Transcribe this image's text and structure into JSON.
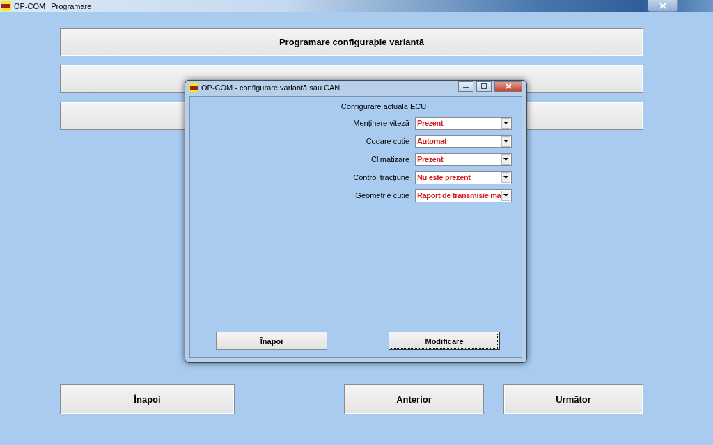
{
  "window": {
    "app_name": "OP-COM",
    "menu": "Programare"
  },
  "top_buttons": [
    {
      "label": "Programare configuraþie variantă"
    }
  ],
  "dialog": {
    "title": "OP-COM - configurare variantă sau CAN",
    "heading": "Configurare actuală ECU",
    "fields": [
      {
        "label": "Menţinere viteză",
        "value": "Prezent"
      },
      {
        "label": "Codare cutie",
        "value": "Automat"
      },
      {
        "label": "Climatizare",
        "value": "Prezent"
      },
      {
        "label": "Control tracţiune",
        "value": "Nu este prezent"
      },
      {
        "label": "Geometrie cutie",
        "value": "Raport de transmisie ma"
      }
    ],
    "buttons": [
      {
        "label": "Înapoi",
        "focused": false
      },
      {
        "label": "Modificare",
        "focused": true
      }
    ]
  },
  "bottom_buttons": [
    {
      "label": "Înapoi"
    },
    {
      "label": "Anterior"
    },
    {
      "label": "Următor"
    }
  ]
}
